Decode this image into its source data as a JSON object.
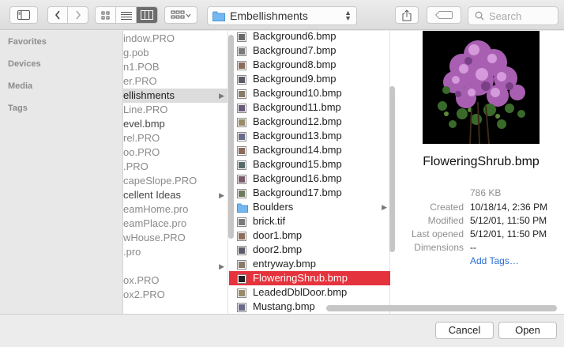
{
  "toolbar": {
    "location": "Embellishments",
    "search_placeholder": "Search"
  },
  "sidebar": {
    "sections": [
      "Favorites",
      "Devices",
      "Media",
      "Tags"
    ]
  },
  "column1": [
    {
      "label": "indow.PRO",
      "dim": true
    },
    {
      "label": "g.pob",
      "dim": true
    },
    {
      "label": "n1.POB",
      "dim": true
    },
    {
      "label": "er.PRO",
      "dim": true
    },
    {
      "label": "ellishments",
      "dim": false,
      "selected": true,
      "folder": true
    },
    {
      "label": "Line.PRO",
      "dim": true
    },
    {
      "label": "evel.bmp",
      "dim": false
    },
    {
      "label": "rel.PRO",
      "dim": true
    },
    {
      "label": "oo.PRO",
      "dim": true
    },
    {
      "label": ".PRO",
      "dim": true
    },
    {
      "label": "capeSlope.PRO",
      "dim": true
    },
    {
      "label": "cellent Ideas",
      "dim": false,
      "folder": true
    },
    {
      "label": "eamHome.pro",
      "dim": true
    },
    {
      "label": "eamPlace.pro",
      "dim": true
    },
    {
      "label": "wHouse.PRO",
      "dim": true
    },
    {
      "label": ".pro",
      "dim": true
    },
    {
      "label": "",
      "dim": true,
      "folder": true
    },
    {
      "label": "ox.PRO",
      "dim": true
    },
    {
      "label": "ox2.PRO",
      "dim": true
    }
  ],
  "column2": [
    {
      "label": "Background6.bmp",
      "icon": "image"
    },
    {
      "label": "Background7.bmp",
      "icon": "image"
    },
    {
      "label": "Background8.bmp",
      "icon": "image"
    },
    {
      "label": "Background9.bmp",
      "icon": "image"
    },
    {
      "label": "Background10.bmp",
      "icon": "image"
    },
    {
      "label": "Background11.bmp",
      "icon": "image"
    },
    {
      "label": "Background12.bmp",
      "icon": "image"
    },
    {
      "label": "Background13.bmp",
      "icon": "image"
    },
    {
      "label": "Background14.bmp",
      "icon": "image"
    },
    {
      "label": "Background15.bmp",
      "icon": "image"
    },
    {
      "label": "Background16.bmp",
      "icon": "image"
    },
    {
      "label": "Background17.bmp",
      "icon": "image"
    },
    {
      "label": "Boulders",
      "icon": "folder"
    },
    {
      "label": "brick.tif",
      "icon": "image"
    },
    {
      "label": "door1.bmp",
      "icon": "image"
    },
    {
      "label": "door2.bmp",
      "icon": "image"
    },
    {
      "label": "entryway.bmp",
      "icon": "image"
    },
    {
      "label": "FloweringShrub.bmp",
      "icon": "image",
      "selected": true
    },
    {
      "label": "LeadedDblDoor.bmp",
      "icon": "image"
    },
    {
      "label": "Mustang.bmp",
      "icon": "image"
    }
  ],
  "preview": {
    "filename": "FloweringShrub.bmp",
    "size": "786 KB",
    "created_label": "Created",
    "created": "10/18/14, 2:36 PM",
    "modified_label": "Modified",
    "modified": "5/12/01, 11:50 PM",
    "opened_label": "Last opened",
    "opened": "5/12/01, 11:50 PM",
    "dimensions_label": "Dimensions",
    "dimensions": "--",
    "add_tags": "Add Tags…"
  },
  "buttons": {
    "cancel": "Cancel",
    "open": "Open"
  },
  "colors": {
    "selection": "#e5333d",
    "link": "#2a6fd6"
  }
}
